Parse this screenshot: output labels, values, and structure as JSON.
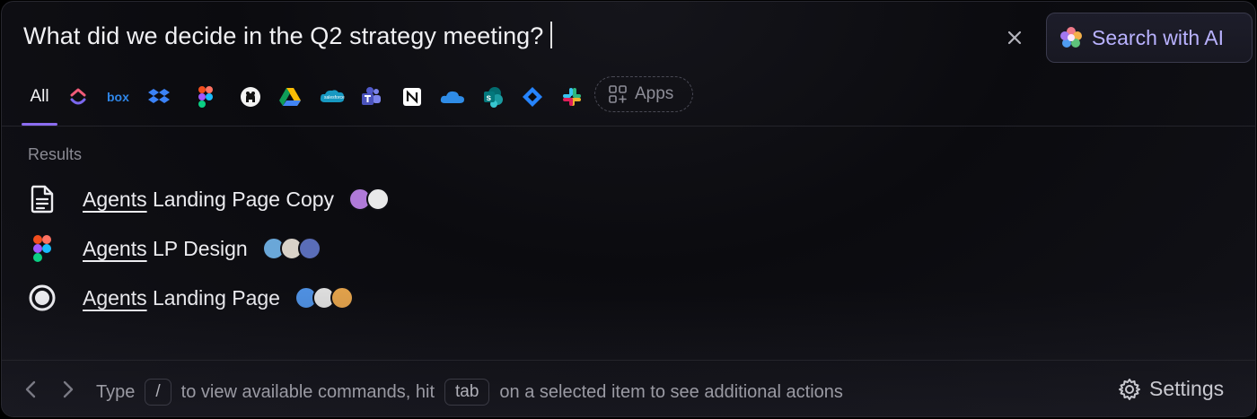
{
  "search": {
    "query": "What did we decide in the Q2 strategy meeting?",
    "ai_button_label": "Search with AI"
  },
  "filters": {
    "all_label": "All",
    "apps": [
      "clickup",
      "box",
      "dropbox",
      "figma",
      "github",
      "google-drive",
      "salesforce",
      "teams",
      "notion",
      "onedrive",
      "sharepoint",
      "jira",
      "slack"
    ],
    "box_text": "box",
    "salesforce_text": "salesforce",
    "apps_button_label": "Apps"
  },
  "results": {
    "section_label": "Results",
    "items": [
      {
        "keyword": "Agents",
        "rest": " Landing Page Copy",
        "icon": "document-icon",
        "avatars": [
          "#b07ad8",
          "#e9e9e9"
        ]
      },
      {
        "keyword": "Agents",
        "rest": " LP Design",
        "icon": "figma-icon",
        "avatars": [
          "#6aa7d8",
          "#d9d2c8",
          "#5a6db8"
        ]
      },
      {
        "keyword": "Agents",
        "rest": " Landing Page",
        "icon": "radio-circle-icon",
        "avatars": [
          "#4e8fe0",
          "#dcdcdc",
          "#e0a04a"
        ]
      }
    ]
  },
  "footer": {
    "hint_type": "Type",
    "hint_slash": "/",
    "hint_middle": "to view available commands, hit",
    "hint_tab": "tab",
    "hint_end": "on a selected item to see additional actions",
    "settings_label": "Settings"
  },
  "colors": {
    "accent": "#8b6cf0",
    "ai_text": "#b9b2ff",
    "background": "#0b0b0f"
  }
}
